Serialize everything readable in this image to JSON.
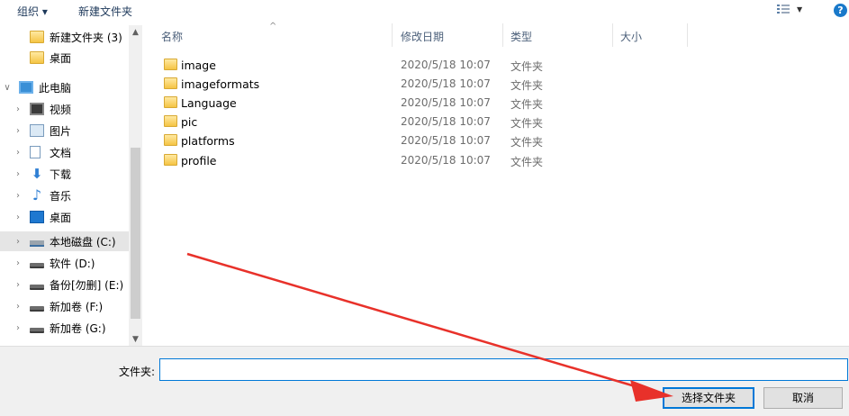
{
  "toolbar": {
    "organize_label": "组织 ▾",
    "new_folder_label": "新建文件夹",
    "help_label": "?"
  },
  "nav": {
    "items": [
      {
        "label": "新建文件夹 (3)",
        "icon": "folder-icon"
      },
      {
        "label": "桌面",
        "icon": "folder-icon"
      },
      {
        "label": "此电脑",
        "icon": "computer-icon"
      },
      {
        "label": "视频",
        "icon": "video-icon"
      },
      {
        "label": "图片",
        "icon": "pictures-icon"
      },
      {
        "label": "文档",
        "icon": "documents-icon"
      },
      {
        "label": "下载",
        "icon": "download-icon"
      },
      {
        "label": "音乐",
        "icon": "music-icon"
      },
      {
        "label": "桌面",
        "icon": "desktop-icon"
      },
      {
        "label": "本地磁盘 (C:)",
        "icon": "system-drive-icon",
        "selected": true
      },
      {
        "label": "软件 (D:)",
        "icon": "drive-icon"
      },
      {
        "label": "备份[勿删] (E:)",
        "icon": "drive-icon"
      },
      {
        "label": "新加卷 (F:)",
        "icon": "drive-icon"
      },
      {
        "label": "新加卷 (G:)",
        "icon": "drive-icon"
      }
    ]
  },
  "columns": {
    "name": "名称",
    "date": "修改日期",
    "type": "类型",
    "size": "大小"
  },
  "files": [
    {
      "name": "image",
      "date": "2020/5/18 10:07",
      "type": "文件夹"
    },
    {
      "name": "imageformats",
      "date": "2020/5/18 10:07",
      "type": "文件夹"
    },
    {
      "name": "Language",
      "date": "2020/5/18 10:07",
      "type": "文件夹"
    },
    {
      "name": "pic",
      "date": "2020/5/18 10:07",
      "type": "文件夹"
    },
    {
      "name": "platforms",
      "date": "2020/5/18 10:07",
      "type": "文件夹"
    },
    {
      "name": "profile",
      "date": "2020/5/18 10:07",
      "type": "文件夹"
    }
  ],
  "bottom": {
    "folder_label": "文件夹:",
    "folder_value": "",
    "select_button": "选择文件夹",
    "cancel_button": "取消"
  },
  "colors": {
    "accent": "#0078d7",
    "arrow": "#e8312a"
  }
}
